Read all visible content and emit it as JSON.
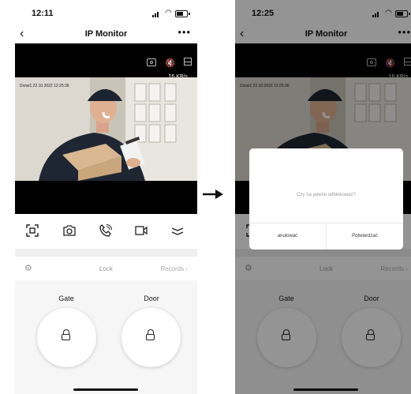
{
  "screens": [
    {
      "status_time": "12:11",
      "nav": {
        "title": "IP Monitor",
        "back_icon": "chevron-left-icon",
        "more_label": "•••"
      },
      "video": {
        "bitrate": "16 KB/s",
        "timestamp": "Drzwi1 22.10.2022 12:25:36"
      },
      "controls": [
        "screenshot-icon",
        "camera-icon",
        "phone-icon",
        "video-record-icon",
        "collapse-icon"
      ],
      "lock_row": {
        "title": "Lock",
        "records": "Records ›"
      },
      "doors": [
        {
          "label": "Gate"
        },
        {
          "label": "Door"
        }
      ]
    },
    {
      "status_time": "12:25",
      "nav": {
        "title": "IP Monitor",
        "back_icon": "chevron-left-icon",
        "more_label": "•••"
      },
      "video": {
        "bitrate": "16 KB/s",
        "timestamp": "Drzwi1 22.10.2022 12:25:36"
      },
      "controls": [
        "screenshot-icon",
        "camera-icon",
        "phone-icon",
        "video-record-icon",
        "collapse-icon"
      ],
      "lock_row": {
        "title": "Lock",
        "records": "Records ›"
      },
      "doors": [
        {
          "label": "Gate"
        },
        {
          "label": "Door"
        }
      ],
      "dialog": {
        "message": "Czy na pewno odblokować?",
        "cancel": "anulować",
        "confirm": "Potwierdzać"
      }
    }
  ],
  "colors": {
    "video_bg": "#000000",
    "panel_bg": "#f6f6f6",
    "muted_text": "#999999",
    "overlay": "rgba(0,0,0,0.42)"
  }
}
